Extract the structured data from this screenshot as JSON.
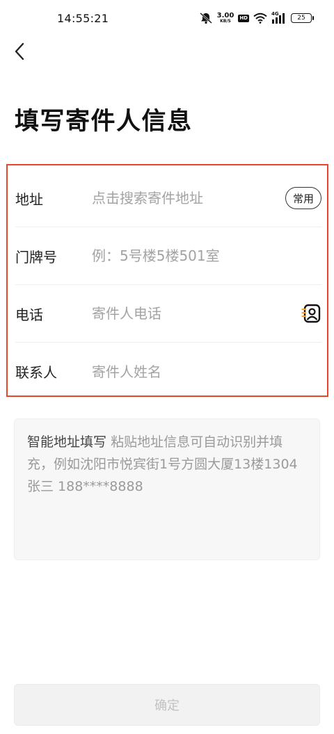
{
  "status_bar": {
    "time": "14:55:21",
    "net_speed_value": "3.00",
    "net_speed_unit": "KB/S",
    "hd_label": "HD",
    "network_type": "4G",
    "battery_level": "25"
  },
  "header": {
    "title": "填写寄件人信息"
  },
  "form": {
    "rows": [
      {
        "label": "地址",
        "placeholder": "点击搜索寄件地址",
        "action_label": "常用"
      },
      {
        "label": "门牌号",
        "placeholder": "例：5号楼5楼501室"
      },
      {
        "label": "电话",
        "placeholder": "寄件人电话"
      },
      {
        "label": "联系人",
        "placeholder": "寄件人姓名"
      }
    ]
  },
  "smart_address": {
    "title": "智能地址填写",
    "hint": "粘贴地址信息可自动识别并填充，例如沈阳市悦宾街1号方圆大厦13楼1304 张三 188****8888"
  },
  "confirm": {
    "label": "确定"
  },
  "colors": {
    "highlight_border": "#e8452c",
    "contact_icon_accent": "#f5a623"
  }
}
